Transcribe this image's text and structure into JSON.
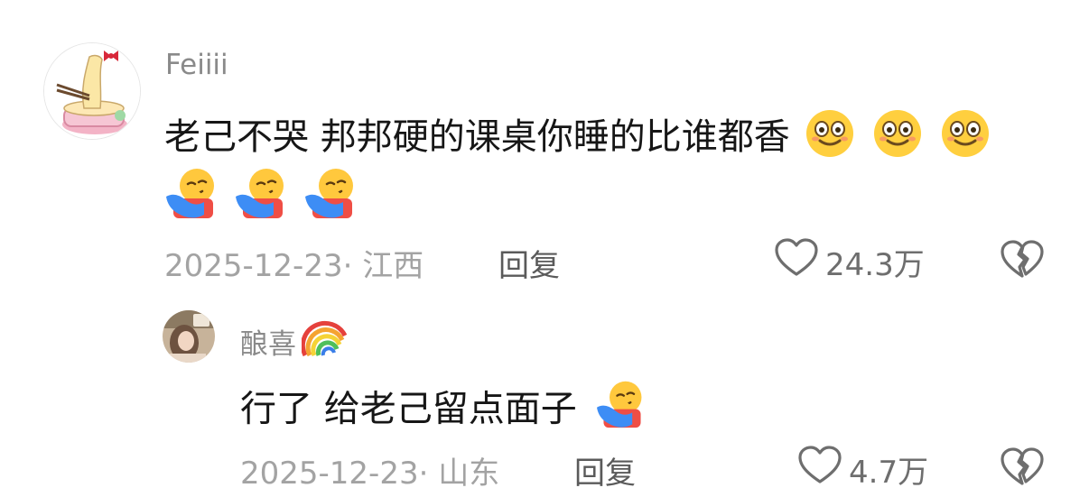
{
  "comments": [
    {
      "username": "Feiiii",
      "text": "老己不哭 邦邦硬的课桌你睡的比谁都香",
      "date_location": "2025-12-23· 江西",
      "reply_label": "回复",
      "like_count": "24.3万",
      "text_emojis": [
        "smiling-face-icon",
        "smiling-face-icon",
        "smiling-face-icon"
      ],
      "second_line_emojis": [
        "hugging-face-icon",
        "hugging-face-icon",
        "hugging-face-icon"
      ]
    },
    {
      "username": "酿喜",
      "username_emoji": "rainbow-icon",
      "text": "行了 给老己留点面子",
      "text_emojis": [
        "hugging-face-icon"
      ],
      "date_location": "2025-12-23· 山东",
      "reply_label": "回复",
      "like_count": "4.7万"
    }
  ]
}
